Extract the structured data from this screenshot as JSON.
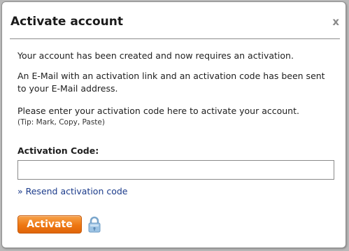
{
  "dialog": {
    "title": "Activate account",
    "close_label": "x"
  },
  "messages": {
    "created": "Your account has been created and now requires an activation.",
    "email_sent": "An E-Mail with an activation link and an activation code has been sent to your E-Mail address.",
    "enter_code": "Please enter your activation code here to activate your account.",
    "tip": "(Tip: Mark, Copy, Paste)"
  },
  "form": {
    "code_label": "Activation Code:",
    "code_value": "",
    "resend_label": "» Resend activation code",
    "activate_label": "Activate"
  },
  "icons": {
    "lock": "lock-icon"
  },
  "colors": {
    "accent": "#ee7712",
    "link": "#1a3a8a",
    "lock": "#8fb6d8"
  }
}
